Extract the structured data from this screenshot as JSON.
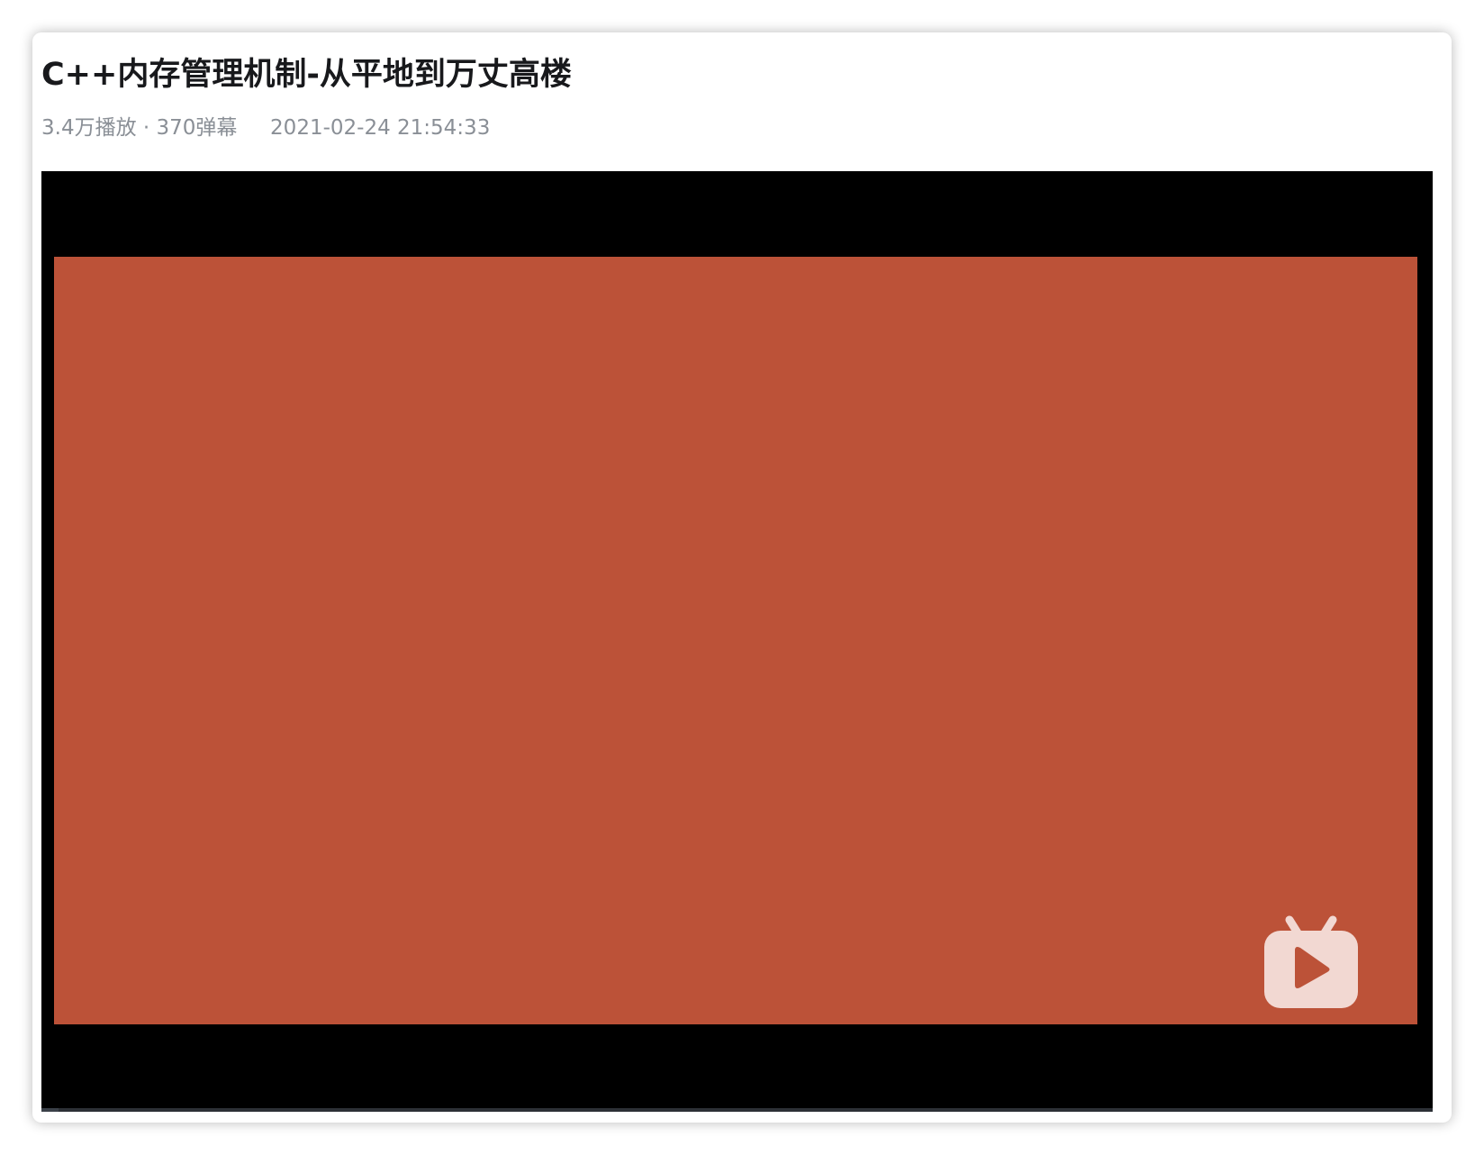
{
  "video": {
    "title": "C++内存管理机制-从平地到万丈高楼",
    "views": "3.4万播放",
    "separator": "·",
    "danmaku": "370弹幕",
    "published": "2021-02-24 21:54:33"
  },
  "player": {
    "slide_color": "#bc5238",
    "logo_icon": "bilibili-tv-play-icon",
    "progress": 0.012
  },
  "colors": {
    "title": "#18191c",
    "meta": "#8a8f96",
    "player_bg": "#000000"
  }
}
